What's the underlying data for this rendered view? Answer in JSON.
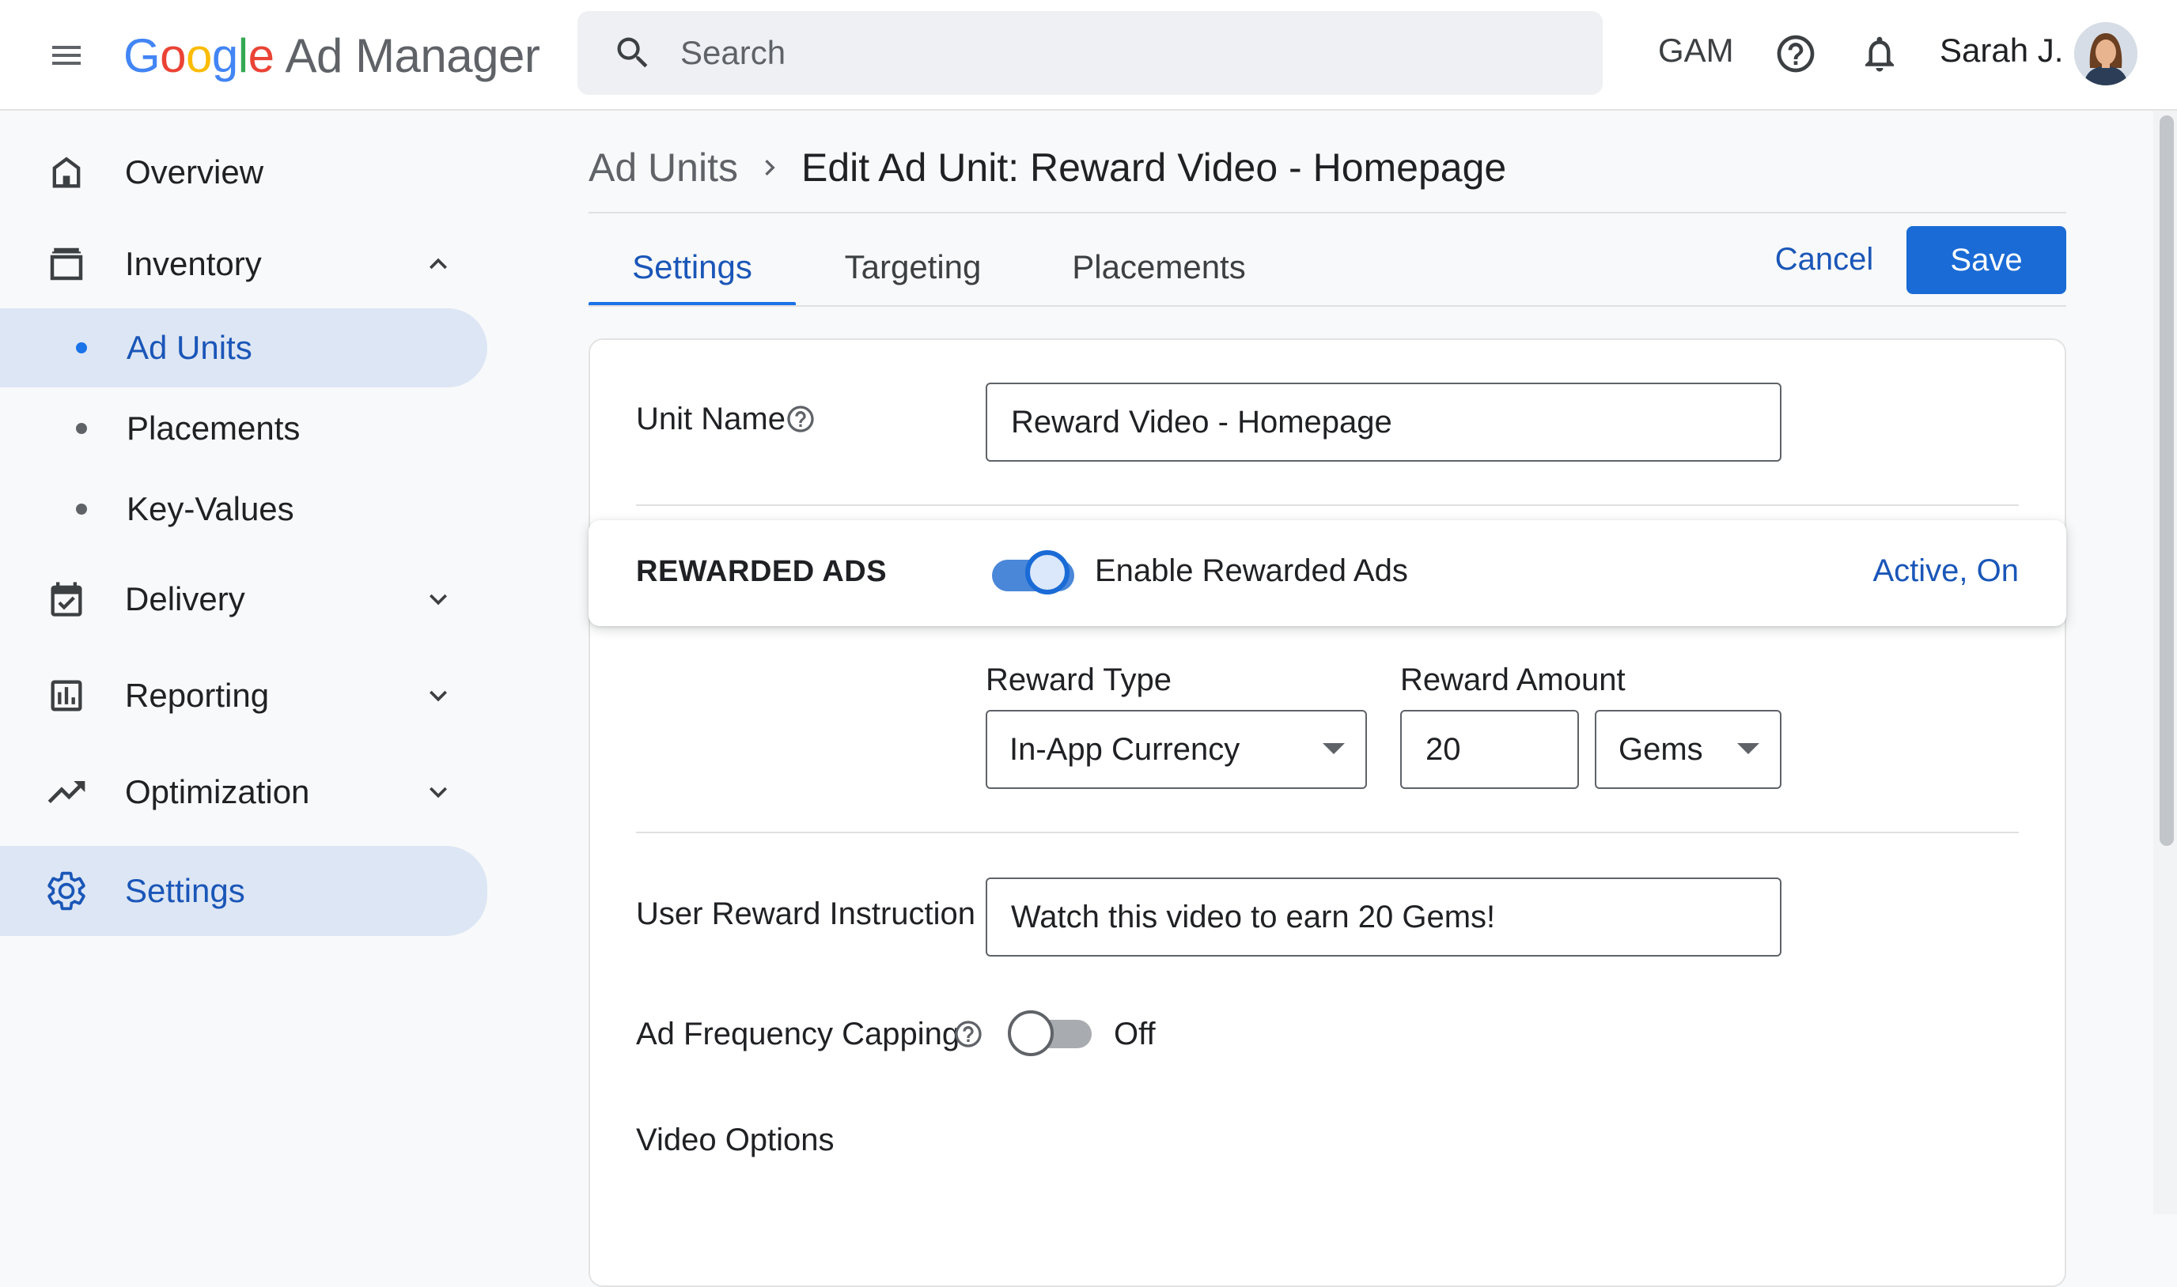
{
  "header": {
    "logo_google_letters": [
      "G",
      "o",
      "o",
      "g",
      "l",
      "e"
    ],
    "product_name": "Ad Manager",
    "search_placeholder": "Search",
    "network_code": "GAM",
    "user_name": "Sarah J."
  },
  "sidebar": {
    "items": [
      {
        "label": "Overview",
        "icon": "home-icon"
      },
      {
        "label": "Inventory",
        "icon": "inventory-icon",
        "expanded": true,
        "children": [
          {
            "label": "Ad Units",
            "active": true
          },
          {
            "label": "Placements"
          },
          {
            "label": "Key-Values"
          }
        ]
      },
      {
        "label": "Delivery",
        "icon": "calendar-check-icon"
      },
      {
        "label": "Reporting",
        "icon": "bar-chart-icon"
      },
      {
        "label": "Optimization",
        "icon": "trending-up-icon"
      },
      {
        "label": "Settings",
        "icon": "gear-icon",
        "active": true
      }
    ]
  },
  "breadcrumb": {
    "parent": "Ad Units",
    "current": "Edit Ad Unit: Reward Video - Homepage"
  },
  "tabs": [
    "Settings",
    "Targeting",
    "Placements"
  ],
  "active_tab": "Settings",
  "actions": {
    "cancel": "Cancel",
    "save": "Save"
  },
  "form": {
    "unit_name": {
      "label": "Unit Name",
      "value": "Reward Video - Homepage"
    },
    "rewarded_ads": {
      "section_title": "REWARDED ADS",
      "toggle_label": "Enable Rewarded Ads",
      "enabled": true,
      "status": "Active, On"
    },
    "reward_type": {
      "label": "Reward Type",
      "value": "In-App Currency"
    },
    "reward_amount": {
      "label": "Reward Amount",
      "value": "20",
      "unit": "Gems"
    },
    "user_reward_instruction": {
      "label": "User Reward Instruction",
      "value": "Watch this video to earn 20 Gems!"
    },
    "frequency_capping": {
      "label": "Ad Frequency Capping",
      "enabled": false,
      "status": "Off"
    },
    "video_options": {
      "title": "Video Options"
    }
  },
  "colors": {
    "accent": "#1a73e8",
    "accent_text": "#1a56b8",
    "save_button": "#1a6bd6",
    "active_nav_bg": "#dde6f4"
  }
}
